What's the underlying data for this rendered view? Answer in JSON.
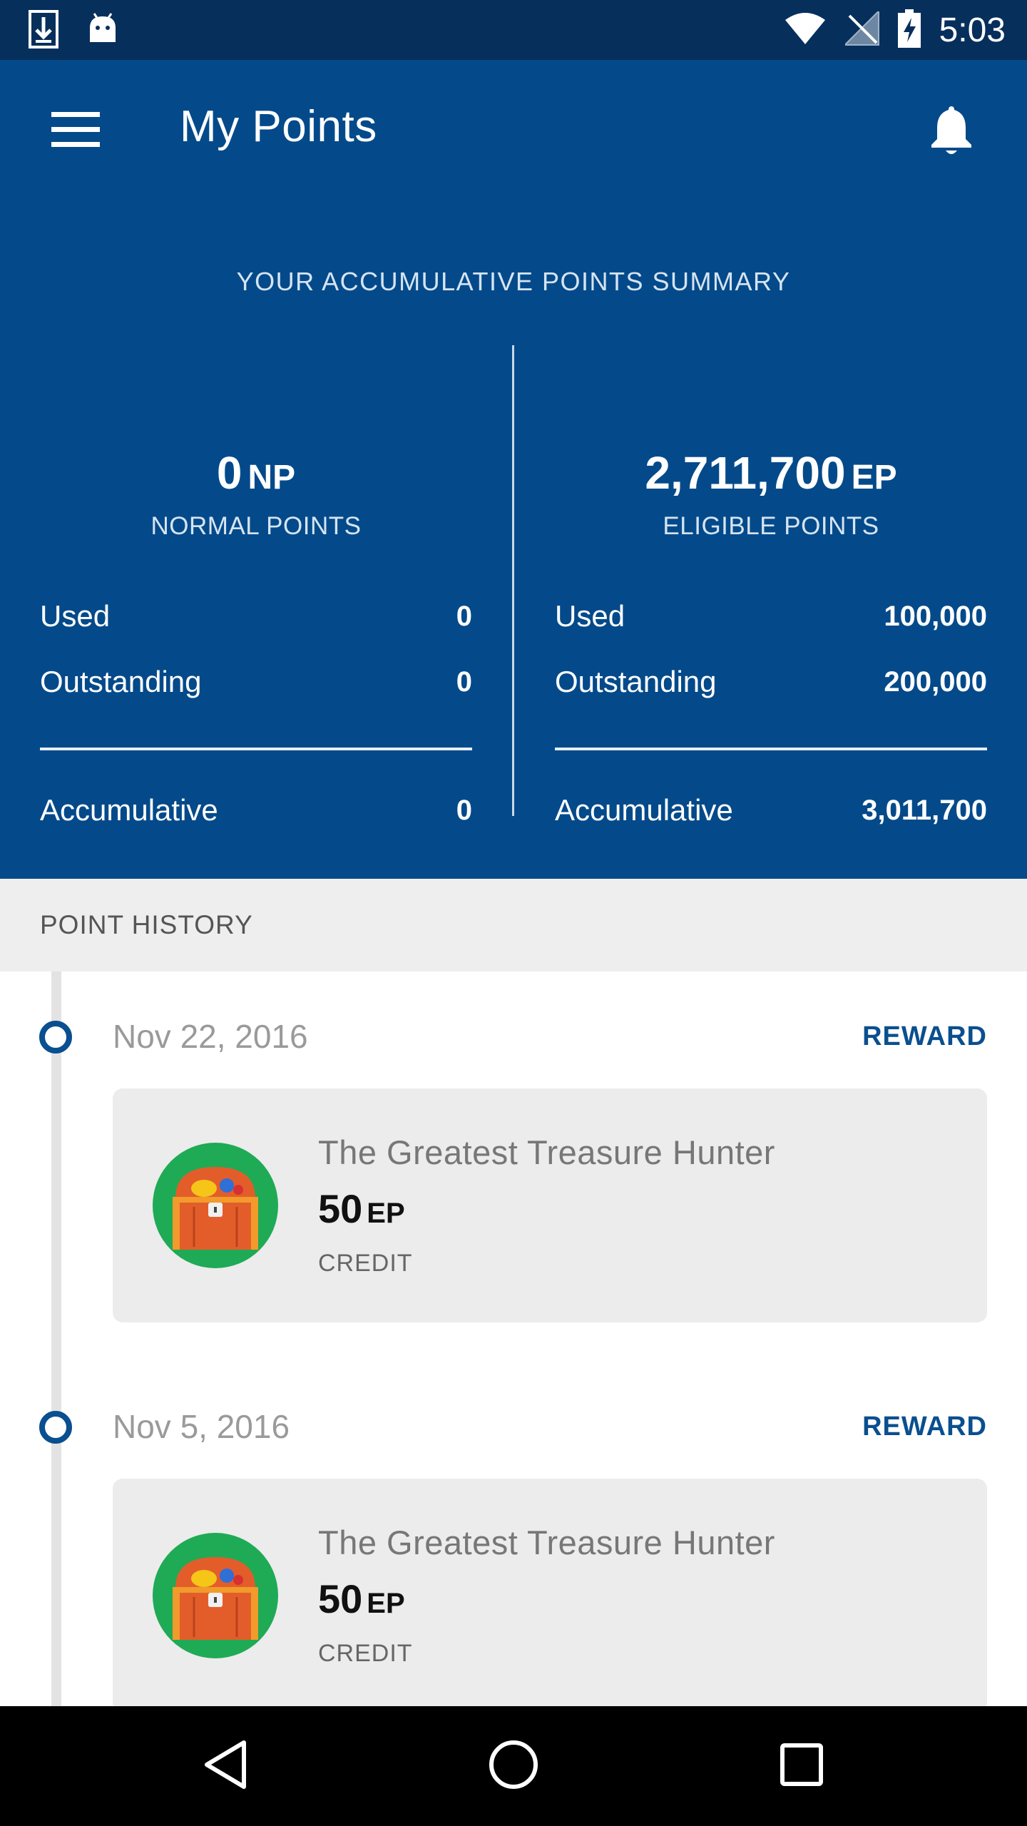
{
  "status_bar": {
    "time": "5:03"
  },
  "app_bar": {
    "title": "My Points"
  },
  "summary": {
    "title": "YOUR ACCUMULATIVE POINTS SUMMARY",
    "normal": {
      "value": "0",
      "unit": "NP",
      "label": "NORMAL POINTS",
      "used_label": "Used",
      "used": "0",
      "outstanding_label": "Outstanding",
      "outstanding": "0",
      "accumulative_label": "Accumulative",
      "accumulative": "0"
    },
    "eligible": {
      "value": "2,711,700",
      "unit": "EP",
      "label": "ELIGIBLE POINTS",
      "used_label": "Used",
      "used": "100,000",
      "outstanding_label": "Outstanding",
      "outstanding": "200,000",
      "accumulative_label": "Accumulative",
      "accumulative": "3,011,700"
    }
  },
  "history": {
    "header": "POINT HISTORY",
    "entries": [
      {
        "date": "Nov 22, 2016",
        "type": "REWARD",
        "title": "The Greatest Treasure Hunter",
        "points": "50",
        "unit": "EP",
        "kind": "CREDIT"
      },
      {
        "date": "Nov 5, 2016",
        "type": "REWARD",
        "title": "The Greatest Treasure Hunter",
        "points": "50",
        "unit": "EP",
        "kind": "CREDIT"
      }
    ]
  },
  "icons": {
    "status_left": [
      "download-icon",
      "android-icon"
    ],
    "status_right": [
      "wifi-icon",
      "no-signal-icon",
      "battery-charging-icon"
    ],
    "app_bar": [
      "menu-icon",
      "bell-icon"
    ],
    "entry": "treasure-chest-icon",
    "nav": [
      "back-icon",
      "home-icon",
      "recents-icon"
    ]
  },
  "colors": {
    "primary": "#044a8a",
    "status_bar": "#062f5c",
    "accent": "#0a4f8f",
    "avatar_bg": "#1faa55"
  }
}
